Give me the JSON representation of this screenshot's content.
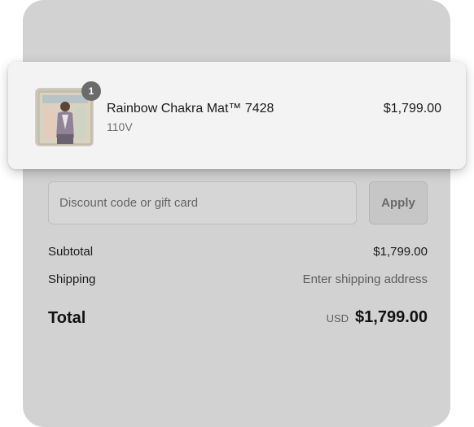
{
  "product": {
    "name": "Rainbow Chakra Mat™ 7428",
    "variant": "110V",
    "price": "$1,799.00",
    "quantity": "1",
    "image_icon": "product-photo-icon"
  },
  "discount": {
    "placeholder": "Discount code or gift card",
    "value": "",
    "apply_label": "Apply"
  },
  "summary": {
    "subtotal_label": "Subtotal",
    "subtotal_value": "$1,799.00",
    "shipping_label": "Shipping",
    "shipping_value": "Enter shipping address",
    "total_label": "Total",
    "currency": "USD",
    "total_value": "$1,799.00"
  },
  "colors": {
    "panel": "#d2d2d2",
    "card": "#f3f3f3",
    "badge": "#6b6b6b"
  }
}
